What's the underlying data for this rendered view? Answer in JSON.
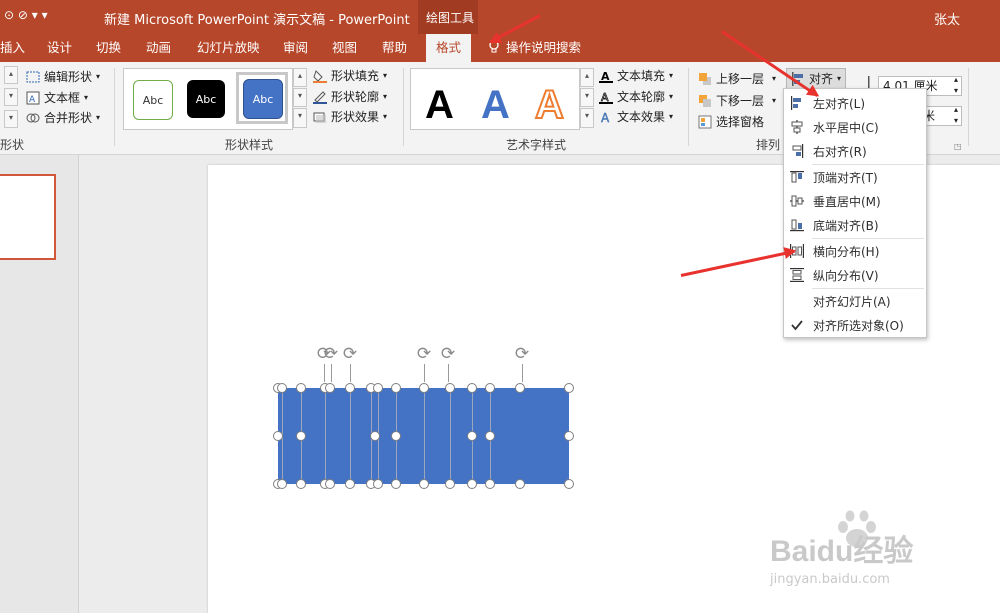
{
  "titlebar": {
    "doc_title": "新建 Microsoft PowerPoint 演示文稿  -  PowerPoint",
    "context_group": "绘图工具",
    "user": "张太",
    "quick_access": "⊙ ⊘ ▾ ▾"
  },
  "tabs": [
    {
      "label": "插入"
    },
    {
      "label": "设计"
    },
    {
      "label": "切换"
    },
    {
      "label": "动画"
    },
    {
      "label": "幻灯片放映"
    },
    {
      "label": "审阅"
    },
    {
      "label": "视图"
    },
    {
      "label": "帮助"
    },
    {
      "label": "格式"
    }
  ],
  "tell_me": "操作说明搜索",
  "ribbon": {
    "insert_shapes": {
      "label": "形状",
      "edit_shape": "编辑形状",
      "text_box": "文本框",
      "merge_shapes": "合并形状"
    },
    "shape_styles": {
      "label": "形状样式",
      "swatches": [
        "Abc",
        "Abc",
        "Abc"
      ],
      "fill": "形状填充",
      "outline": "形状轮廓",
      "effects": "形状效果"
    },
    "wordart": {
      "label": "艺术字样式",
      "letters": [
        "A",
        "A",
        "A"
      ],
      "text_fill": "文本填充",
      "text_outline": "文本轮廓",
      "text_effects": "文本效果"
    },
    "arrange": {
      "label": "排列",
      "bring_forward": "上移一层",
      "send_backward": "下移一层",
      "selection_pane": "选择窗格",
      "align": "对齐"
    },
    "size": {
      "height": "4.01 厘米",
      "width_suffix": "米"
    }
  },
  "align_menu": {
    "items": [
      {
        "label": "左对齐(L)",
        "icon": "align-left-icon"
      },
      {
        "label": "水平居中(C)",
        "icon": "align-center-icon"
      },
      {
        "label": "右对齐(R)",
        "icon": "align-right-icon"
      },
      {
        "label": "顶端对齐(T)",
        "icon": "align-top-icon"
      },
      {
        "label": "垂直居中(M)",
        "icon": "align-middle-icon"
      },
      {
        "label": "底端对齐(B)",
        "icon": "align-bottom-icon"
      },
      {
        "label": "横向分布(H)",
        "icon": "distribute-horizontal-icon"
      },
      {
        "label": "纵向分布(V)",
        "icon": "distribute-vertical-icon"
      },
      {
        "label": "对齐幻灯片(A)",
        "icon": ""
      },
      {
        "label": "对齐所选对象(O)",
        "icon": "checkmark-icon",
        "checked": true
      }
    ]
  },
  "watermark": {
    "brand": "Baidu经验",
    "url": "jingyan.baidu.com"
  },
  "colors": {
    "title_bar": "#b7472a",
    "shape_fill": "#4472c4",
    "annotation_arrow": "#e8322e"
  }
}
